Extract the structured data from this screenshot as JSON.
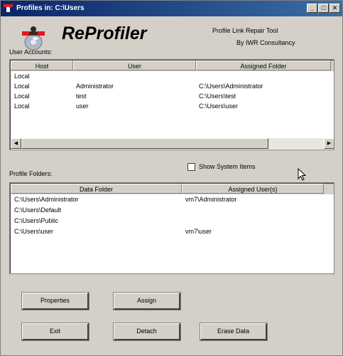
{
  "window": {
    "title": "Profiles in: C:\\Users",
    "controls": {
      "minimize": "_",
      "maximize": "□",
      "close": "✕"
    }
  },
  "branding": {
    "app_name": "ReProfiler",
    "tagline": "Profile Link Repair Tool",
    "company": "By IWR Consultancy",
    "logo_icon": "profile-disk-icon"
  },
  "accounts": {
    "label": "User Accounts:",
    "columns": [
      "Host",
      "User",
      "Assigned Folder"
    ],
    "rows": [
      [
        "Local",
        "",
        ""
      ],
      [
        "Local",
        "Administrator",
        "C:\\Users\\Administrator"
      ],
      [
        "Local",
        "test",
        "C:\\Users\\test"
      ],
      [
        "Local",
        "user",
        "C:\\Users\\user"
      ]
    ]
  },
  "show_system": {
    "label": "Show System Items",
    "checked": false
  },
  "folders": {
    "label": "Profile Folders:",
    "columns": [
      "Data Folder",
      "Assigned User(s)"
    ],
    "rows": [
      [
        "C:\\Users\\Administrator",
        "vm7\\Administrator"
      ],
      [
        "C:\\Users\\Default",
        ""
      ],
      [
        "C:\\Users\\Public",
        ""
      ],
      [
        "C:\\Users\\user",
        "vm7\\user"
      ]
    ]
  },
  "buttons": {
    "properties": "Properties",
    "assign": "Assign",
    "exit": "Exit",
    "detach": "Detach",
    "erase_data": "Erase Data"
  },
  "scroll_arrows": {
    "left": "◀",
    "right": "▶"
  }
}
